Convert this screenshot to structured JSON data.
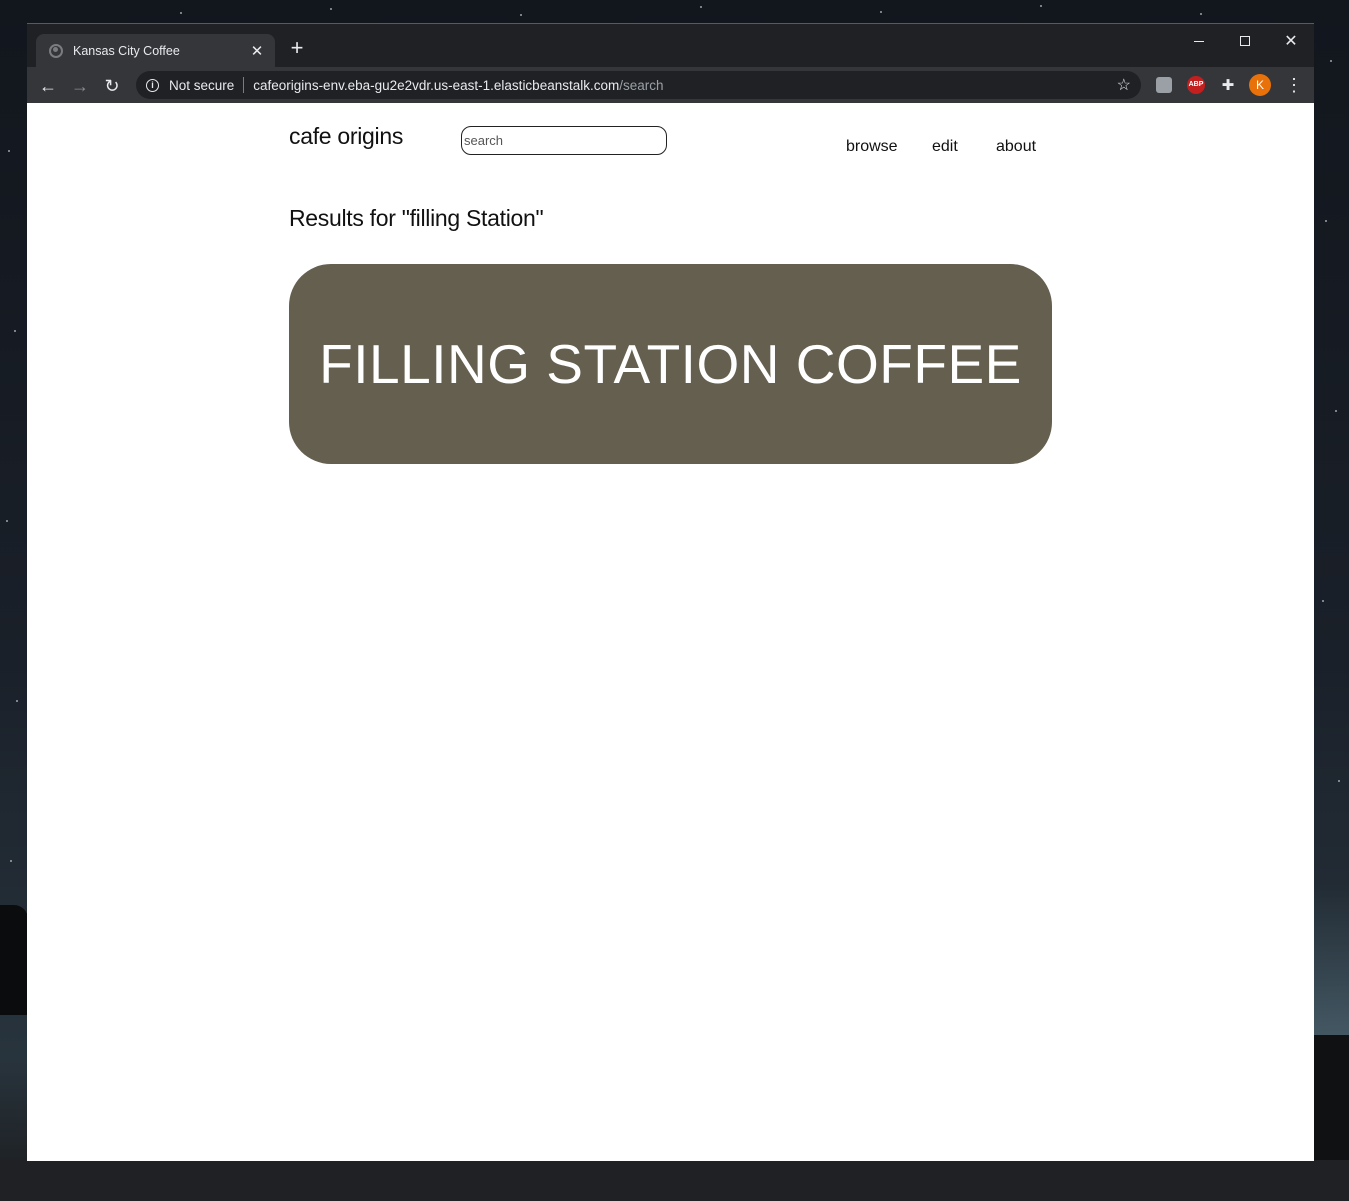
{
  "browser": {
    "tab_title": "Kansas City Coffee",
    "tab_close": "✕",
    "new_tab": "+",
    "security_label": "Not secure",
    "url_host": "cafeorigins-env.eba-gu2e2vdr.us-east-1.elasticbeanstalk.com",
    "url_path": "/search",
    "profile_initial": "K",
    "abp_label": "ABP"
  },
  "site": {
    "name": "cafe origins",
    "search_placeholder": "search",
    "nav": {
      "browse": "browse",
      "edit": "edit",
      "about": "about"
    }
  },
  "results": {
    "heading": "Results for \"filling Station\"",
    "items": [
      {
        "name": "FILLING STATION COFFEE"
      }
    ]
  },
  "colors": {
    "card_background": "#645f4f",
    "browser_frame": "#202124",
    "toolbar": "#35363a",
    "avatar": "#e8710a"
  }
}
